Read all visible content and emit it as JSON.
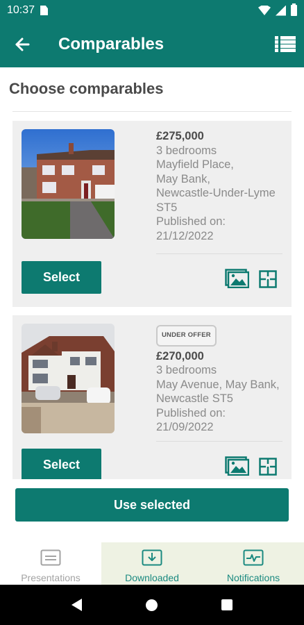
{
  "status_bar": {
    "time": "10:37"
  },
  "app_bar": {
    "title": "Comparables"
  },
  "page": {
    "heading": "Choose comparables"
  },
  "comparables": [
    {
      "badge": "",
      "price": "£275,000",
      "bedrooms": "3 bedrooms",
      "address_lines": [
        "Mayfield Place,",
        "May Bank,",
        "Newcastle-Under-Lyme",
        "ST5"
      ],
      "published_label": "Published on:",
      "published_date": "21/12/2022",
      "select_label": "Select"
    },
    {
      "badge": "UNDER OFFER",
      "price": "£270,000",
      "bedrooms": "3 bedrooms",
      "address_lines": [
        "May Avenue, May Bank,",
        "Newcastle ST5"
      ],
      "published_label": "Published on:",
      "published_date": "21/09/2022",
      "select_label": "Select"
    }
  ],
  "footer": {
    "use_selected_label": "Use selected"
  },
  "bottom_tabs": [
    {
      "label": "Presentations",
      "icon": "presentation-icon"
    },
    {
      "label": "Downloaded",
      "icon": "download-icon"
    },
    {
      "label": "Notifications",
      "icon": "activity-icon"
    }
  ],
  "colors": {
    "primary": "#0d7a70",
    "card_bg": "#efefef",
    "tab_active_bg": "#eef2e3"
  }
}
